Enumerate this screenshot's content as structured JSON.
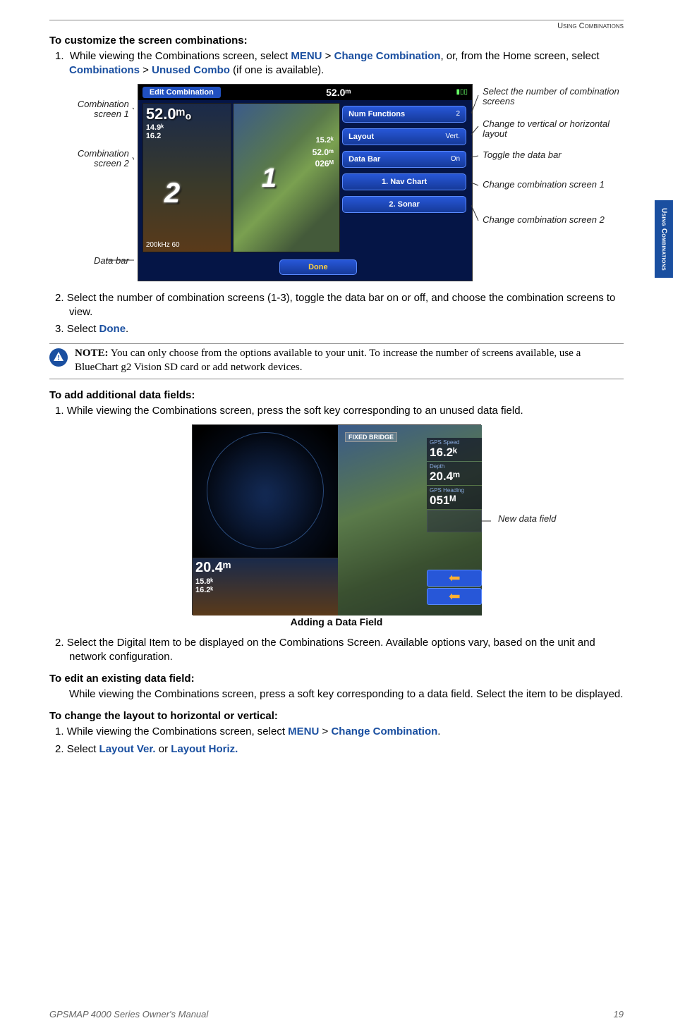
{
  "header": {
    "section": "Using Combinations"
  },
  "sideTab": "Using\nCombinations",
  "h1": "To customize the screen combinations:",
  "step1": {
    "num": "1.",
    "pre": "While viewing the Combinations screen, select ",
    "kw1": "MENU",
    "gt1": " > ",
    "kw2": "Change Combination",
    "mid": ", or, from the Home screen, select ",
    "kw3": "Combinations",
    "gt2": " > ",
    "kw4": "Unused Combo",
    "post": " (if one is available)."
  },
  "diagram1": {
    "leftLabels": {
      "l1": "Combination screen 1",
      "l2": "Combination screen 2",
      "l3": "Data bar"
    },
    "rightLabels": {
      "r1": "Select the number of combination screens",
      "r2": "Change to vertical or horizontal layout",
      "r3": "Toggle the data bar",
      "r4": "Change combination screen 1",
      "r5": "Change combination screen 2"
    },
    "titlebar": {
      "title": "Edit Combination",
      "depth": "52.0ᵐ"
    },
    "sonar": {
      "big": "52.0ᵐ₀",
      "s1": "14.9ᵏ",
      "s2": "16.2",
      "zoom": "2",
      "freq": "200kHz  60"
    },
    "chart": {
      "one": "1",
      "spd": "15.2ᵏ",
      "d2": "52.0ᵐ",
      "hd": "026ᴹ"
    },
    "buttons": {
      "b1": {
        "label": "Num Functions",
        "val": "2"
      },
      "b2": {
        "label": "Layout",
        "val": "Vert."
      },
      "b3": {
        "label": "Data Bar",
        "val": "On"
      },
      "b4": "1. Nav Chart",
      "b5": "2. Sonar",
      "done": "Done"
    }
  },
  "step2": {
    "num": "2.",
    "text": "Select the number of combination screens (1-3), toggle the data bar on or off, and choose the combination screens to view."
  },
  "step3": {
    "num": "3.",
    "pre": "Select ",
    "kw": "Done",
    "post": "."
  },
  "note": {
    "bold": "NOTE:",
    "text": " You can only choose from the options available to your unit. To increase the number of screens available, use a BlueChart g2 Vision SD card or add network devices."
  },
  "h2": "To add additional data fields:",
  "step4": {
    "num": "1.",
    "text": "While viewing the Combinations screen, press the soft key corresponding to an unused data field."
  },
  "diagram2": {
    "bridge": "FIXED BRIDGE",
    "sonar": {
      "big": "20.4ᵐ",
      "s1": "15.8ᵏ",
      "s2": "16.2ᵏ"
    },
    "data": {
      "d1": {
        "lbl": "GPS Speed",
        "v": "16.2ᵏ"
      },
      "d2": {
        "lbl": "Depth",
        "v": "20.4ᵐ"
      },
      "d3": {
        "lbl": "GPS Heading",
        "v": "051ᴹ"
      }
    },
    "newField": "New data field"
  },
  "figCaption": "Adding a Data Field",
  "step5": {
    "num": "2.",
    "text": "Select the Digital Item to be displayed on the Combinations Screen. Available options vary, based on the unit and network configuration."
  },
  "h3": "To edit an existing data field:",
  "step6": "While viewing the Combinations screen, press a soft key corresponding to a data field. Select the item to be displayed.",
  "h4": "To change the layout to horizontal or vertical:",
  "step7": {
    "num": "1.",
    "pre": "While viewing the Combinations screen, select ",
    "kw1": "MENU",
    "gt": " > ",
    "kw2": "Change Combination",
    "post": "."
  },
  "step8": {
    "num": "2.",
    "pre": "Select ",
    "kw1": "Layout Ver.",
    "mid": " or ",
    "kw2": "Layout Horiz."
  },
  "footer": {
    "left": "GPSMAP 4000 Series Owner's Manual",
    "page": "19"
  }
}
